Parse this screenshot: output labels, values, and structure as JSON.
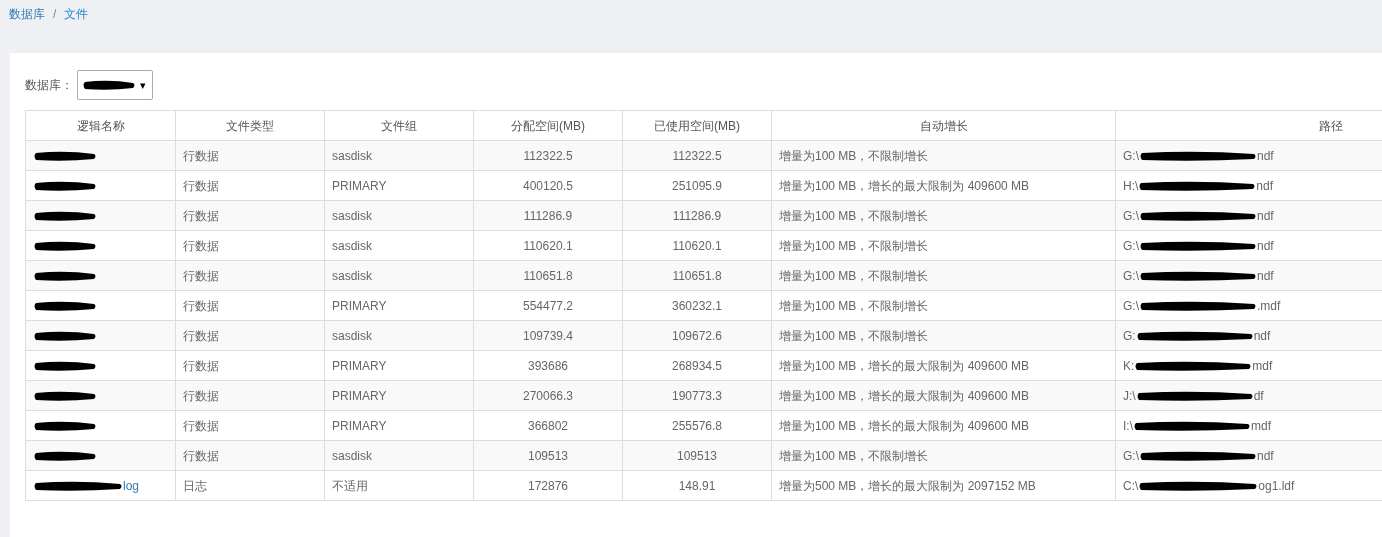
{
  "breadcrumb": [
    {
      "label": "数据库",
      "current": false
    },
    {
      "label": "文件",
      "current": true
    }
  ],
  "breadcrumb_separator": "/",
  "database_select": {
    "label": "数据库：",
    "redacted": true,
    "caret": "▾"
  },
  "table": {
    "columns": [
      "逻辑名称",
      "文件类型",
      "文件组",
      "分配空间(MB)",
      "已使用空间(MB)",
      "自动增长",
      "路径"
    ],
    "rows": [
      {
        "name": {
          "redacted": true
        },
        "type": "行数据",
        "filegroup": "sasdisk",
        "allocated": "112322.5",
        "used": "112322.5",
        "growth": "增量为100 MB，不限制增长",
        "path": {
          "prefix": "G:\\",
          "redacted": true,
          "suffix": "ndf"
        }
      },
      {
        "name": {
          "redacted": true
        },
        "type": "行数据",
        "filegroup": "PRIMARY",
        "allocated": "400120.5",
        "used": "251095.9",
        "growth": "增量为100 MB，增长的最大限制为 409600 MB",
        "path": {
          "prefix": "H:\\",
          "redacted": true,
          "suffix": "ndf"
        }
      },
      {
        "name": {
          "redacted": true
        },
        "type": "行数据",
        "filegroup": "sasdisk",
        "allocated": "111286.9",
        "used": "111286.9",
        "growth": "增量为100 MB，不限制增长",
        "path": {
          "prefix": "G:\\",
          "redacted": true,
          "suffix": "ndf"
        }
      },
      {
        "name": {
          "redacted": true
        },
        "type": "行数据",
        "filegroup": "sasdisk",
        "allocated": "110620.1",
        "used": "110620.1",
        "growth": "增量为100 MB，不限制增长",
        "path": {
          "prefix": "G:\\",
          "redacted": true,
          "suffix": "ndf"
        }
      },
      {
        "name": {
          "redacted": true
        },
        "type": "行数据",
        "filegroup": "sasdisk",
        "allocated": "110651.8",
        "used": "110651.8",
        "growth": "增量为100 MB，不限制增长",
        "path": {
          "prefix": "G:\\",
          "redacted": true,
          "suffix": "ndf"
        }
      },
      {
        "name": {
          "redacted": true
        },
        "type": "行数据",
        "filegroup": "PRIMARY",
        "allocated": "554477.2",
        "used": "360232.1",
        "growth": "增量为100 MB，不限制增长",
        "path": {
          "prefix": "G:\\",
          "redacted": true,
          "suffix": ".mdf"
        }
      },
      {
        "name": {
          "redacted": true
        },
        "type": "行数据",
        "filegroup": "sasdisk",
        "allocated": "109739.4",
        "used": "109672.6",
        "growth": "增量为100 MB，不限制增长",
        "path": {
          "prefix": "G:",
          "redacted": true,
          "suffix": "ndf"
        }
      },
      {
        "name": {
          "redacted": true
        },
        "type": "行数据",
        "filegroup": "PRIMARY",
        "allocated": "393686",
        "used": "268934.5",
        "growth": "增量为100 MB，增长的最大限制为 409600 MB",
        "path": {
          "prefix": "K:",
          "redacted": true,
          "suffix": "mdf"
        }
      },
      {
        "name": {
          "redacted": true
        },
        "type": "行数据",
        "filegroup": "PRIMARY",
        "allocated": "270066.3",
        "used": "190773.3",
        "growth": "增量为100 MB，增长的最大限制为 409600 MB",
        "path": {
          "prefix": "J:\\",
          "redacted": true,
          "suffix": "df"
        }
      },
      {
        "name": {
          "redacted": true
        },
        "type": "行数据",
        "filegroup": "PRIMARY",
        "allocated": "366802",
        "used": "255576.8",
        "growth": "增量为100 MB，增长的最大限制为 409600 MB",
        "path": {
          "prefix": "I:\\",
          "redacted": true,
          "suffix": "mdf"
        }
      },
      {
        "name": {
          "redacted": true
        },
        "type": "行数据",
        "filegroup": "sasdisk",
        "allocated": "109513",
        "used": "109513",
        "growth": "增量为100 MB，不限制增长",
        "path": {
          "prefix": "G:\\",
          "redacted": true,
          "suffix": "ndf"
        }
      },
      {
        "name": {
          "redacted": true,
          "suffix": "log"
        },
        "type": "日志",
        "filegroup": "不适用",
        "allocated": "172876",
        "used": "148.91",
        "growth": "增量为500 MB，增长的最大限制为 2097152 MB",
        "path": {
          "prefix": "C:\\",
          "redacted": true,
          "suffix": "og1.ldf"
        }
      }
    ]
  }
}
